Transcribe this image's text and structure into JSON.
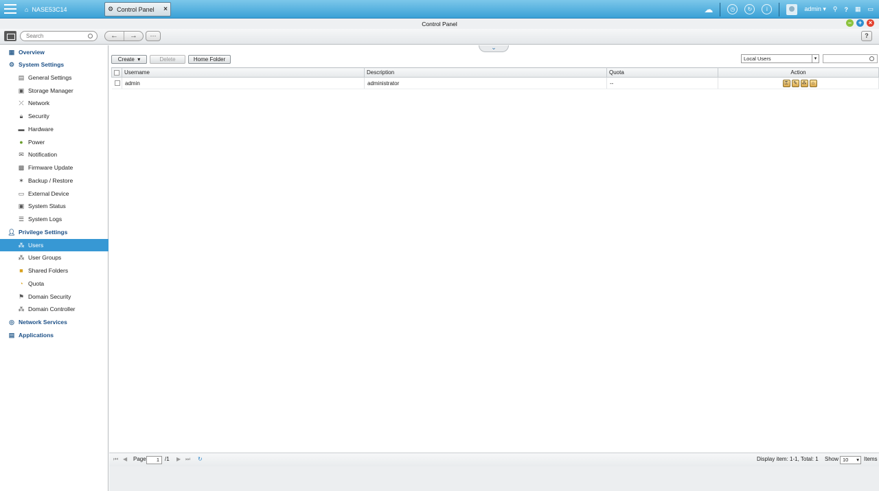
{
  "topbar": {
    "home_label": "NASE53C14",
    "app_tab_label": "Control Panel",
    "app_tab_close": "×",
    "user_name": "admin",
    "help": "?"
  },
  "window": {
    "title": "Control Panel"
  },
  "toolbar": {
    "search_placeholder": "Search",
    "back": "←",
    "forward": "→",
    "grid": "⋯",
    "help": "?"
  },
  "sidebar": {
    "overview": "Overview",
    "system_settings": "System Settings",
    "system_items": [
      "General Settings",
      "Storage Manager",
      "Network",
      "Security",
      "Hardware",
      "Power",
      "Notification",
      "Firmware Update",
      "Backup / Restore",
      "External Device",
      "System Status",
      "System Logs"
    ],
    "privilege_settings": "Privilege Settings",
    "privilege_items": [
      "Users",
      "User Groups",
      "Shared Folders",
      "Quota",
      "Domain Security",
      "Domain Controller"
    ],
    "network_services": "Network Services",
    "applications": "Applications"
  },
  "actions": {
    "create": "Create",
    "delete": "Delete",
    "home_folder": "Home Folder",
    "user_type": "Local Users"
  },
  "table": {
    "headers": [
      "Username",
      "Description",
      "Quota",
      "Action"
    ],
    "rows": [
      {
        "username": "admin",
        "description": "administrator",
        "quota": "--"
      }
    ]
  },
  "pager": {
    "page_label": "Page",
    "page_value": "1",
    "page_total": "/1",
    "display_info": "Display item: 1-1, Total: 1",
    "show_label": "Show",
    "show_value": "10",
    "items_label": "Items"
  },
  "colors": {
    "accent": "#3798d4",
    "category_text": "#1b4f86"
  }
}
